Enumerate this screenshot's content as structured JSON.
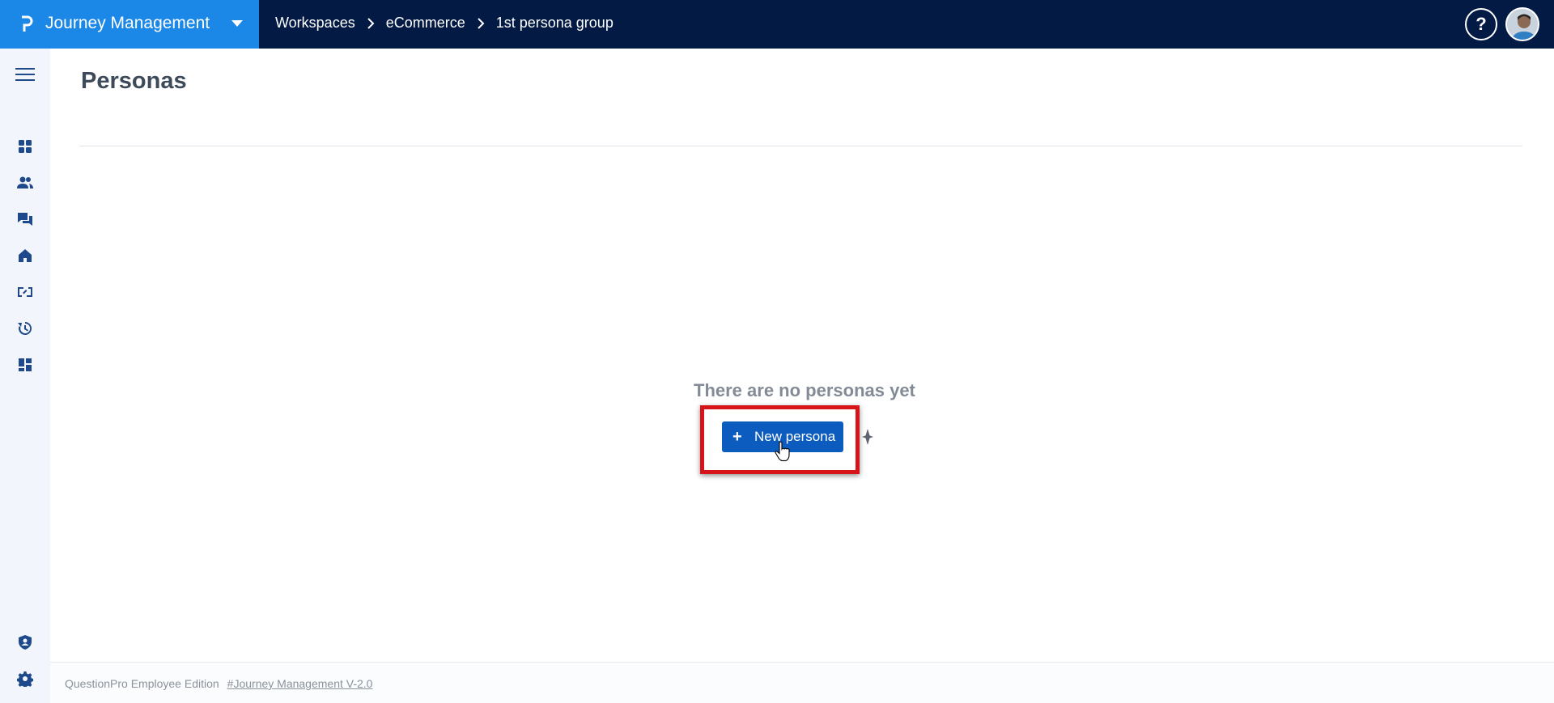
{
  "app": {
    "title": "Journey Management"
  },
  "breadcrumb": [
    "Workspaces",
    "eCommerce",
    "1st persona group"
  ],
  "header": {
    "help_label": "?"
  },
  "sidebar": {
    "items": [
      {
        "name": "dashboard-icon"
      },
      {
        "name": "users-icon"
      },
      {
        "name": "chat-icon"
      },
      {
        "name": "home-icon"
      },
      {
        "name": "map-icon"
      },
      {
        "name": "history-icon"
      },
      {
        "name": "widgets-icon"
      },
      {
        "name": "shield-icon"
      },
      {
        "name": "gear-icon"
      }
    ]
  },
  "page": {
    "title": "Personas",
    "empty_message": "There are no personas yet",
    "new_button_icon": "+",
    "new_button_label": "New persona"
  },
  "footer": {
    "edition": "QuestionPro Employee Edition",
    "version_link": "#Journey Management V-2.0"
  },
  "colors": {
    "topbar": "#031a45",
    "brand": "#1b87e6",
    "primary_button": "#0c5bbf",
    "highlight": "#d7141a"
  }
}
